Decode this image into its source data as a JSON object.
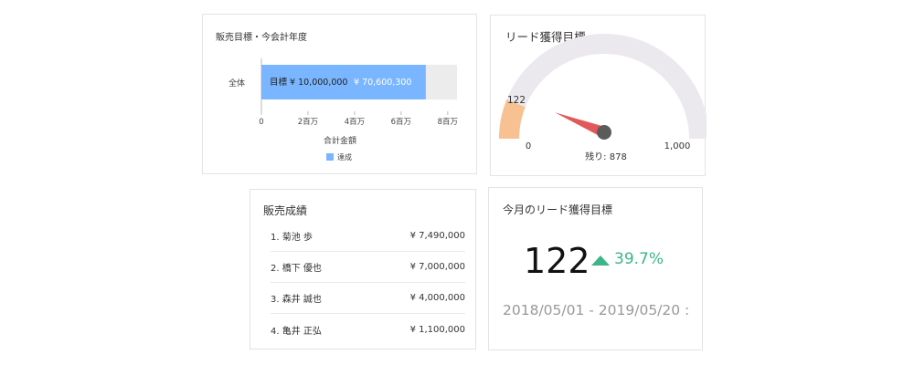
{
  "sales_goal_card": {
    "title": "販売目標・今会計年度",
    "category_label": "全体",
    "target_label": "目標 ¥ 10,000,000",
    "actual_label": "¥ 70,600,300",
    "xaxis_title": "合計金額",
    "legend_label": "達成",
    "colors": {
      "bar": "#7ab6ff",
      "track": "#ececec"
    },
    "chart_data": {
      "type": "bar",
      "categories": [
        "全体"
      ],
      "series": [
        {
          "name": "達成",
          "values": [
            7.06
          ]
        }
      ],
      "xticks": [
        "0",
        "2百万",
        "4百万",
        "6百万",
        "8百万"
      ],
      "xlabel": "合計金額",
      "xlim": [
        0,
        8.4
      ]
    }
  },
  "lead_gauge_card": {
    "title": "リード獲得目標",
    "current_value_label": "122",
    "min_label": "0",
    "max_label": "1,000",
    "remaining_label": "残り: 878",
    "colors": {
      "fill": "#f8c192",
      "track": "#ece9ee",
      "needle": "#e05a5a",
      "hub": "#5b5b5b"
    },
    "gauge": {
      "min": 0,
      "max": 1000,
      "value": 122
    }
  },
  "ranking_card": {
    "title": "販売成績",
    "items": [
      {
        "name": "1. 菊池 歩",
        "amount": "¥ 7,490,000"
      },
      {
        "name": "2. 橋下 優也",
        "amount": "¥ 7,000,000"
      },
      {
        "name": "3. 森井 誠也",
        "amount": "¥ 4,000,000"
      },
      {
        "name": "4. 亀井 正弘",
        "amount": "¥ 1,100,000"
      }
    ]
  },
  "kpi_card": {
    "title": "今月のリード獲得目標",
    "value": "122",
    "change": "39.7%",
    "period": "2018/05/01 - 2019/05/20 :",
    "colors": {
      "up": "#3cb589"
    }
  }
}
